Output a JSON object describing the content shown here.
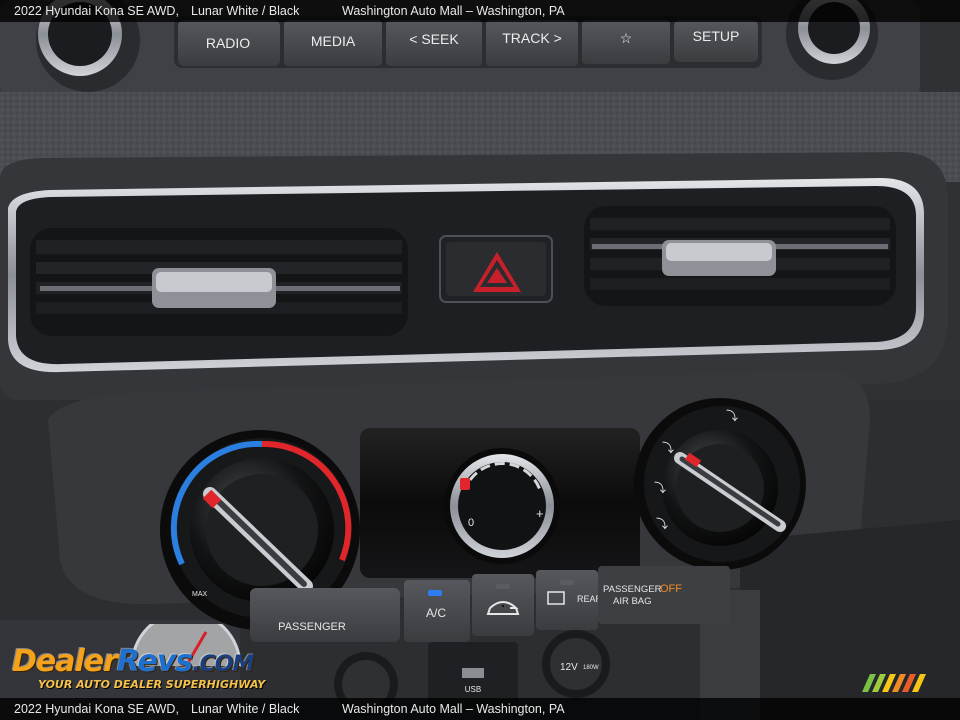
{
  "caption": {
    "vehicle": "2022 Hyundai Kona SE AWD,",
    "color": "Lunar White / Black",
    "dealer": "Washington Auto Mall – Washington, PA"
  },
  "radio_buttons": [
    "RADIO",
    "MEDIA",
    "< SEEK",
    "TRACK >",
    "☆",
    "SETUP"
  ],
  "climate": {
    "fan_min": "0",
    "fan_max": "+",
    "passenger_label": "PASSENGER",
    "ac_label": "A/C",
    "rear_label": "REAR",
    "airbag_label_1": "PASSENGER",
    "airbag_label_2": "AIR BAG",
    "airbag_status": "OFF",
    "usb_label": "USB",
    "power_label": "12V",
    "power_rating": "180W",
    "temp_max": "MAX"
  },
  "watermark": {
    "brand_part1": "Dealer",
    "brand_part2": "Revs",
    "brand_part3": ".COM",
    "tagline": "YOUR AUTO DEALER SUPERHIGHWAY"
  },
  "colors": {
    "hazard": "#c8202a",
    "ac_indicator": "#2f7df0",
    "airbag_off": "#f08a24",
    "temp_cold": "#2a7fe0",
    "temp_hot": "#e0262a"
  }
}
